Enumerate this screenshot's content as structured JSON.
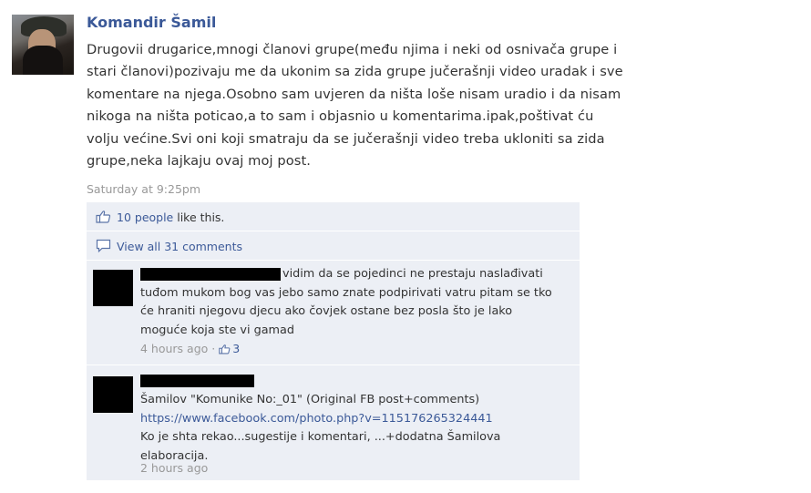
{
  "post": {
    "author": "Komandir Šamil",
    "text": "Drugovii drugarice,mnogi članovi grupe(među njima i neki od osnivača grupe i stari članovi)pozivaju me da ukonim sa zida grupe jučerašnji video uradak i sve komentare na njega.Osobno sam uvjeren da ništa loše nisam uradio i da nisam nikoga na ništa poticao,a to sam i objasnio u komentarima.ipak,poštivat ću volju većine.Svi oni koji smatraju da se jučerašnji video treba ukloniti sa zida grupe,neka lajkaju ovaj moj post.",
    "timestamp": "Saturday at 9:25pm"
  },
  "ufi": {
    "likes_link": "10 people",
    "likes_suffix": " like this.",
    "view_all": "View all 31 comments"
  },
  "comments": [
    {
      "text": "vidim da se pojedinci ne prestaju naslađivati tuđom mukom bog vas jebo samo znate podpirivati vatru pitam se tko će hraniti njegovu djecu ako čovjek ostane bez posla što je lako moguće koja ste vi gamad",
      "time": "4 hours ago",
      "likes": "3"
    },
    {
      "line1": "Šamilov \"Komunike No:_01\" (Original FB post+comments)",
      "url": "https://www.facebook.com/photo.php?v=115176265324441",
      "line2": "Ko je shta rekao...sugestije i komentari, ...+dodatna Šamilova elaboracija.",
      "time": "2 hours ago"
    }
  ],
  "colors": {
    "link": "#3b5998",
    "ufi_bg": "#eceff5",
    "meta": "#999999"
  },
  "icons": {
    "like": "thumbs-up-icon",
    "comment": "comment-icon"
  }
}
